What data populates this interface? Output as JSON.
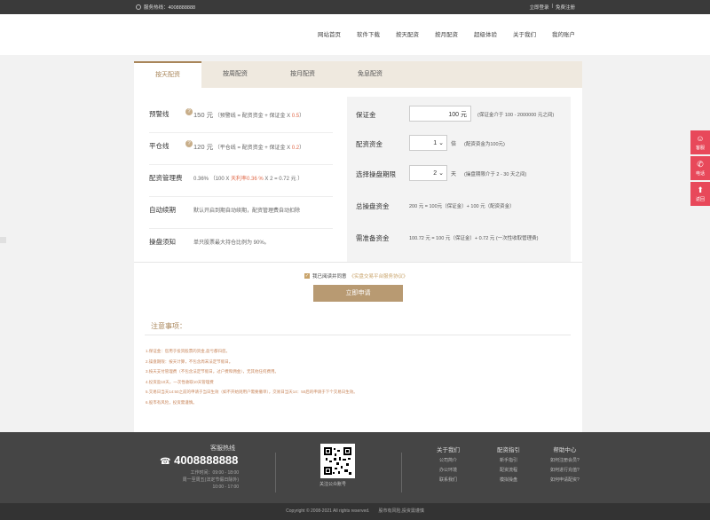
{
  "topbar": {
    "hotline_label": "服务热线：4008888888",
    "login": "立即登录",
    "sep": "|",
    "register": "免费注册"
  },
  "nav": {
    "items": [
      "网站首页",
      "软件下载",
      "按天配资",
      "按月配资",
      "超级体验",
      "关于我们",
      "我的账户"
    ]
  },
  "tabs": [
    "按天配资",
    "按周配资",
    "按月配资",
    "免息配资"
  ],
  "left_rows": [
    {
      "label": "预警线",
      "amount": "150 元",
      "formula_a": "（预警线 = 配资资金 + 保证金 X ",
      "formula_red": "0.5",
      "formula_b": "）"
    },
    {
      "label": "平仓线",
      "amount": "120 元",
      "formula_a": "（平仓线 = 配资资金 + 保证金 X ",
      "formula_red": "0.2",
      "formula_b": "）"
    },
    {
      "label": "配资管理费",
      "amount": "0.36%",
      "formula_a": "（100 X ",
      "formula_red": "天利率0.36 %",
      "formula_b": " X 2 = 0.72 元 ）"
    },
    {
      "label": "自动续期",
      "text": "默认开启到期自动续期，配资管理费自动扣除"
    },
    {
      "label": "操盘须知",
      "text": "单只股票最大持仓比例为 90%。"
    }
  ],
  "right_rows": {
    "margin": {
      "label": "保证金",
      "value": "100",
      "unit": "元",
      "hint": "(保证金介于 100 - 2000000 元之间)"
    },
    "leverage": {
      "label": "配资资金",
      "value": "1",
      "unit": "倍",
      "hint": "(配资资金为100元)"
    },
    "period": {
      "label": "选择操盘期限",
      "value": "2",
      "unit": "天",
      "hint": "(操盘期限介于 2 - 30 天之间)"
    },
    "total": {
      "label": "总操盘资金",
      "text": "200 元 = 100元（保证金）+ 100 元（配资资金）"
    },
    "prep": {
      "label": "需准备资金",
      "text": "100.72 元 = 100 元（保证金）+ 0.72 元 (一次性收取管理费)"
    }
  },
  "agree": {
    "check": "✓",
    "text": "我已阅读并同意",
    "link": "《实盘交易平台服务协议》"
  },
  "submit_label": "立即申请",
  "notice": {
    "title": "注意事项：",
    "items": [
      "1.保证金：您用于投资股票的资金,盈亏都归您。",
      "2.操盘期限：按天计算，不包含周末法定节假日。",
      "3.按天支付管理费（不包含法定节假日，过户费和佣金），无其他任何费用。",
      "4.投资盈10天，一次性收取10天管理费",
      "5.交易日当天14:50之前的申请于当日生效（如不开始则用户需要撤单），交易日当天14：50后的申请于下个交易日生效。",
      "6.股市有风险，投资需谨慎。"
    ]
  },
  "side": {
    "service": "客服",
    "phone": "电话",
    "top": "返回"
  },
  "footer": {
    "hotline_title": "客服热线",
    "phone_icon": "☎",
    "hotline": "4008888888",
    "work_label": "工作时间：09:00 - 18:00",
    "work_days": "周一至周五(法定节假日除外)",
    "work_weekend": "10:00 - 17:00",
    "qr_caption": "关注公众账号",
    "cols": [
      {
        "title": "关于我们",
        "items": [
          "公司简介",
          "办公环境",
          "联系我们"
        ]
      },
      {
        "title": "配资指引",
        "items": [
          "新手指引",
          "配资流程",
          "模拟操盘"
        ]
      },
      {
        "title": "帮助中心",
        "items": [
          "如何注册会员?",
          "如何进行充值?",
          "如何申请配资?"
        ]
      }
    ],
    "copyright": "Copyright © 2008-2021 All rights reserved.　　股市有风险,投资需谨慎"
  }
}
